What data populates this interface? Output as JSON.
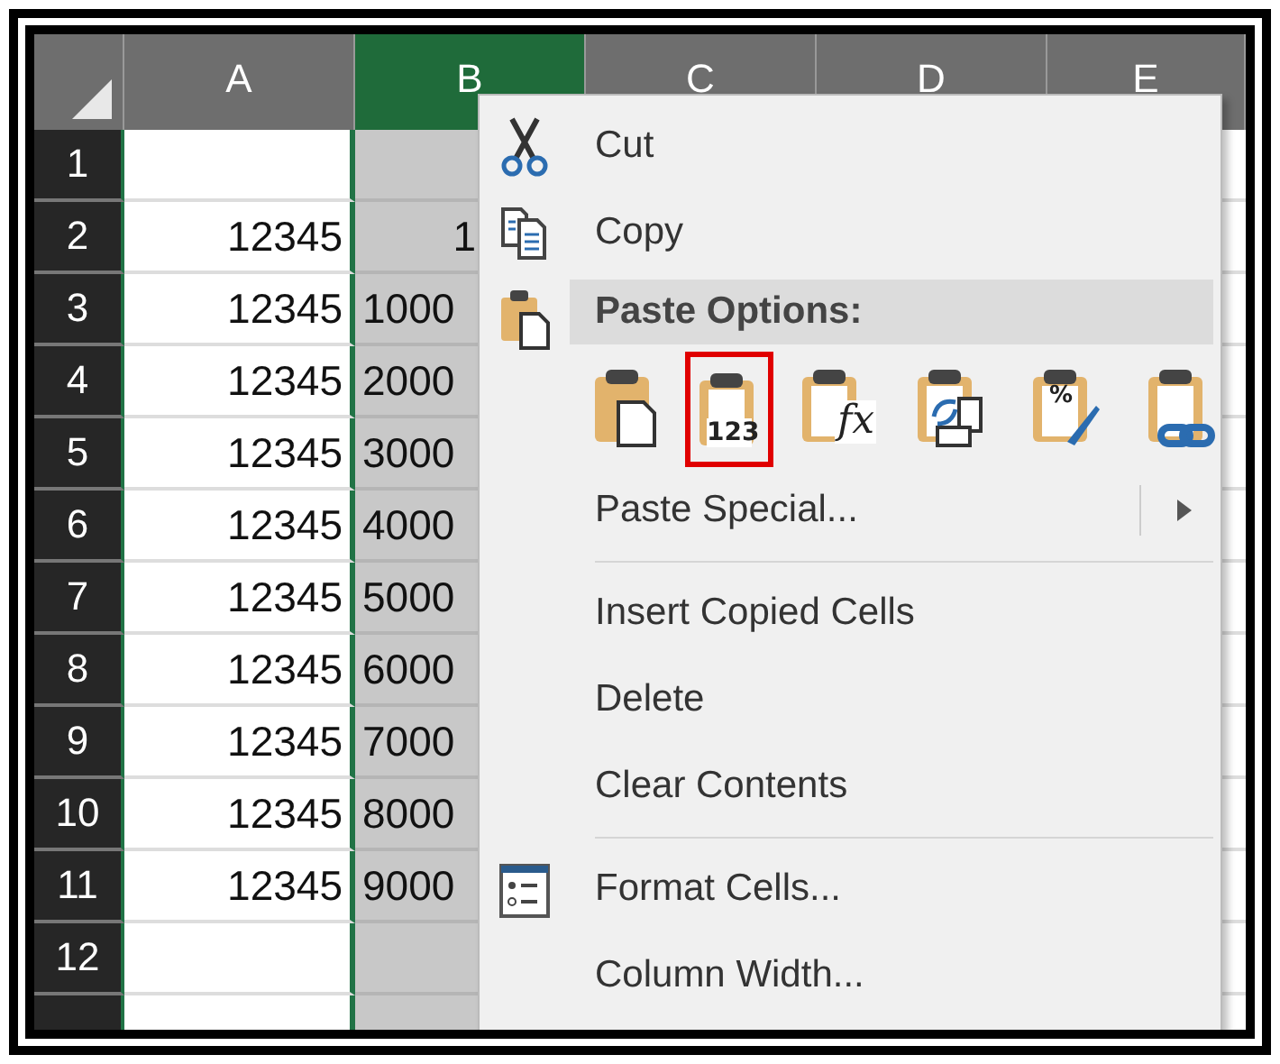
{
  "sheet": {
    "columns": [
      {
        "label": "A",
        "selected": false
      },
      {
        "label": "B",
        "selected": true
      },
      {
        "label": "C",
        "selected": false
      },
      {
        "label": "D",
        "selected": false
      },
      {
        "label": "E",
        "selected": false
      }
    ],
    "rows": [
      {
        "number": "1"
      },
      {
        "number": "2",
        "a": "12345",
        "b": "1"
      },
      {
        "number": "3",
        "a": "12345",
        "b": "1000"
      },
      {
        "number": "4",
        "a": "12345",
        "b": "2000"
      },
      {
        "number": "5",
        "a": "12345",
        "b": "3000"
      },
      {
        "number": "6",
        "a": "12345",
        "b": "4000"
      },
      {
        "number": "7",
        "a": "12345",
        "b": "5000"
      },
      {
        "number": "8",
        "a": "12345",
        "b": "6000"
      },
      {
        "number": "9",
        "a": "12345",
        "b": "7000"
      },
      {
        "number": "10",
        "a": "12345",
        "b": "8000"
      },
      {
        "number": "11",
        "a": "12345",
        "b": "9000"
      },
      {
        "number": "12"
      },
      {}
    ]
  },
  "context_menu": {
    "items": [
      {
        "kind": "cut",
        "label": "Cut"
      },
      {
        "kind": "copy",
        "label": "Copy"
      },
      {
        "kind": "paste-header",
        "label": "Paste Options:"
      },
      {
        "kind": "paste-options",
        "options": [
          {
            "kind": "paste",
            "selected": false
          },
          {
            "kind": "values",
            "text": "123",
            "selected": true
          },
          {
            "kind": "formulas",
            "text": "fx",
            "selected": false
          },
          {
            "kind": "transpose",
            "selected": false
          },
          {
            "kind": "formatting",
            "text": "%",
            "selected": false
          },
          {
            "kind": "link",
            "selected": false
          }
        ]
      },
      {
        "kind": "submenu",
        "label": "Paste Special..."
      },
      {
        "kind": "separator"
      },
      {
        "kind": "plain",
        "label": "Insert Copied Cells"
      },
      {
        "kind": "plain",
        "label": "Delete"
      },
      {
        "kind": "plain",
        "label": "Clear Contents"
      },
      {
        "kind": "separator"
      },
      {
        "kind": "format",
        "label": "Format Cells..."
      },
      {
        "kind": "plain",
        "label": "Column Width..."
      }
    ]
  }
}
